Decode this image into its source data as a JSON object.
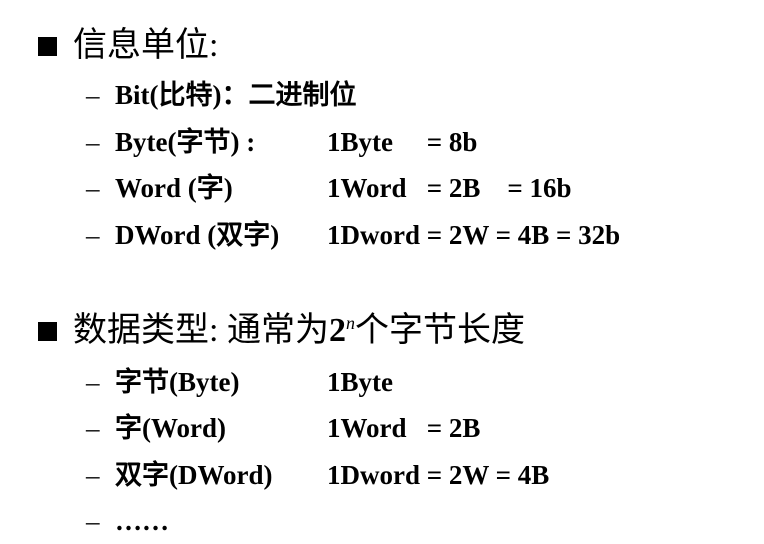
{
  "section1": {
    "title": "信息单位:",
    "items": [
      {
        "label": "Bit(比特)：二进制位",
        "value": ""
      },
      {
        "label": "Byte(字节) :",
        "value": "1Byte     = 8b"
      },
      {
        "label": "Word (字)",
        "value": "1Word   = 2B    = 16b"
      },
      {
        "label": "DWord (双字)",
        "value": "1Dword = 2W = 4B = 32b"
      }
    ]
  },
  "section2": {
    "title_pre": "数据类型:  通常为",
    "title_base": "2",
    "title_exp": "n",
    "title_post": "个字节长度",
    "items": [
      {
        "label": "字节(Byte)",
        "value": "1Byte"
      },
      {
        "label": "字(Word)",
        "value": "1Word   = 2B"
      },
      {
        "label": "双字(DWord)",
        "value": "1Dword = 2W = 4B"
      },
      {
        "label": "……",
        "value": ""
      }
    ]
  },
  "bullet_dash": "–"
}
